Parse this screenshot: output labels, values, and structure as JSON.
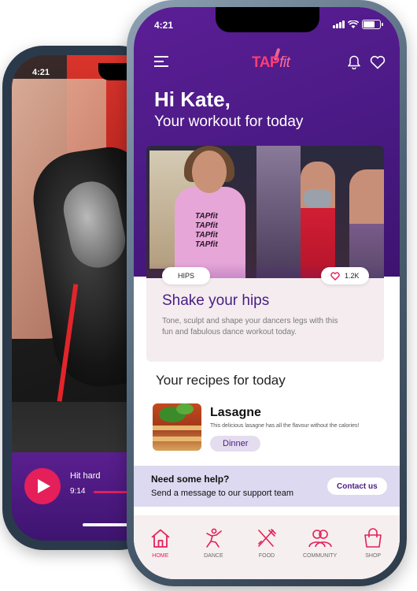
{
  "back_phone": {
    "status_time": "4:21",
    "player": {
      "track_title": "Hit hard",
      "track_time": "9:14"
    }
  },
  "status_bar": {
    "time": "4:21"
  },
  "header": {
    "logo_main": "TAP",
    "logo_accent": "fit"
  },
  "greeting": {
    "title": "Hi Kate,",
    "subtitle": "Your workout for today"
  },
  "workout": {
    "shirt_text": [
      "TAPfit",
      "TAPfit",
      "TAPfit",
      "TAPfit"
    ],
    "tag": "HIPS",
    "likes": "1.2K",
    "title": "Shake your hips",
    "description": "Tone, sculpt and shape your dancers legs with this fun and fabulous dance workout today."
  },
  "recipes": {
    "heading": "Your recipes for today",
    "items": [
      {
        "title": "Lasagne",
        "description": "This delicious lasagne has all the flavour without the calories!",
        "tag": "Dinner"
      }
    ]
  },
  "help": {
    "title": "Need some help?",
    "subtitle": "Send a message to our support team",
    "button": "Contact us"
  },
  "nav": {
    "items": [
      {
        "label": "HOME",
        "icon": "home-icon",
        "active": true
      },
      {
        "label": "DANCE",
        "icon": "dance-icon",
        "active": false
      },
      {
        "label": "FOOD",
        "icon": "food-icon",
        "active": false
      },
      {
        "label": "COMMUNITY",
        "icon": "community-icon",
        "active": false
      },
      {
        "label": "SHOP",
        "icon": "shop-icon",
        "active": false
      }
    ]
  },
  "colors": {
    "brand_purple": "#4a1a84",
    "accent_pink": "#e41f5a",
    "card_bg": "#f4ecef",
    "help_bg": "#ddd9f0",
    "nav_bg": "#f6efef"
  }
}
